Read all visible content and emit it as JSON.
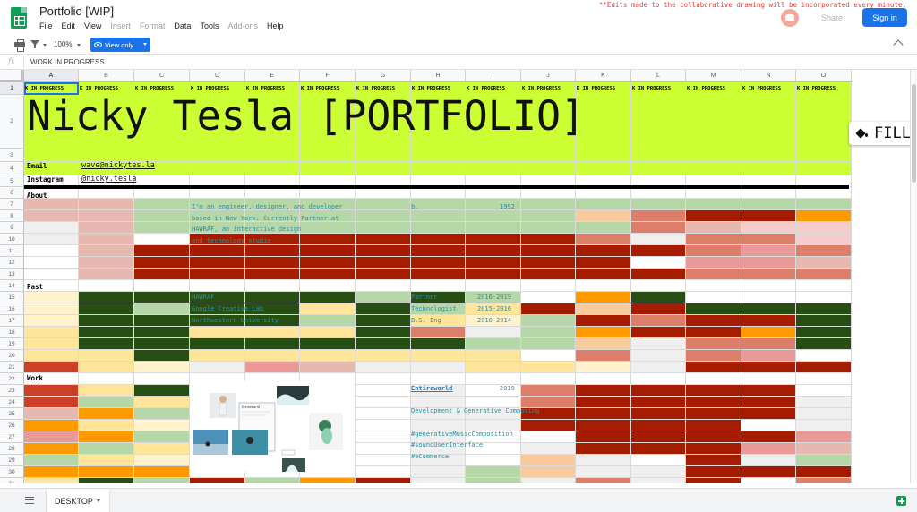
{
  "app": {
    "title": "Portfolio [WIP]",
    "notice": "**Edits made to the collaborative drawing will be incorporated every minute.",
    "share_label": "Share",
    "signin_label": "Sign in"
  },
  "menu": [
    {
      "label": "File",
      "disabled": false
    },
    {
      "label": "Edit",
      "disabled": false
    },
    {
      "label": "View",
      "disabled": false
    },
    {
      "label": "Insert",
      "disabled": true
    },
    {
      "label": "Format",
      "disabled": true
    },
    {
      "label": "Data",
      "disabled": false
    },
    {
      "label": "Tools",
      "disabled": false
    },
    {
      "label": "Add-ons",
      "disabled": true
    },
    {
      "label": "Help",
      "disabled": false
    }
  ],
  "toolbar": {
    "zoom": "100%",
    "view_mode": "View only"
  },
  "formula_bar": {
    "fx_label": "fx",
    "value": "WORK IN PROGRESS"
  },
  "columns": [
    "A",
    "B",
    "C",
    "D",
    "E",
    "F",
    "G",
    "H",
    "I",
    "J",
    "K",
    "L",
    "M",
    "N",
    "O"
  ],
  "rows": [
    "1",
    "2",
    "3",
    "4",
    "5",
    "6",
    "7",
    "8",
    "9",
    "10",
    "11",
    "12",
    "13",
    "14",
    "15",
    "16",
    "17",
    "18",
    "19",
    "20",
    "21",
    "22",
    "23",
    "24",
    "25",
    "26",
    "27",
    "28",
    "29",
    "30",
    "31",
    "32"
  ],
  "sheet": {
    "row1_text": "K IN PROGRESS",
    "title": "Nicky Tesla [PORTFOLIO]",
    "email_label": "Email",
    "email_value": "wave@nickytes.la",
    "instagram_label": "Instagram",
    "instagram_value": "@nicky.tesla",
    "about_label": "About",
    "about_lines": [
      "I'm an engineer, designer, and developer",
      "based in New York. Currently Partner at",
      "HAWRAF, an interactive design",
      "and technology studio"
    ],
    "born_label": "b.",
    "born_year": "1992",
    "past_label": "Past",
    "past_orgs": [
      "HAWRAF",
      "Google Creative Lab",
      "Northwestern University"
    ],
    "past_roles": [
      "Partner",
      "Technologist",
      "B.S. Eng"
    ],
    "past_years": [
      "2016-2019",
      "2015-2016",
      "2010-2014"
    ],
    "work_label": "Work",
    "work_title": "Entireworld",
    "work_year": "2019",
    "work_desc": "Development & Generative Composing",
    "work_tags": [
      "#generativeMusicComposition",
      "#soundUserInterface",
      "#eCommerce"
    ],
    "gallery_label": "Entireworld"
  },
  "fill_label": "FILL",
  "sheet_tab": "DESKTOP",
  "colors": {
    "highlight": "#ccff33",
    "accent": "#1a73e8",
    "dark_red": "#a61c00",
    "dark_green": "#274e13",
    "orange": "#ff9900",
    "light_green": "#b6d7a8",
    "light_red": "#e6b8af",
    "salmon": "#dd7e6b"
  },
  "icons": [
    "print-icon",
    "filter-icon",
    "eye-icon",
    "paint-bucket-icon",
    "collapse-icon",
    "sheets-menu-icon",
    "explore-icon"
  ]
}
